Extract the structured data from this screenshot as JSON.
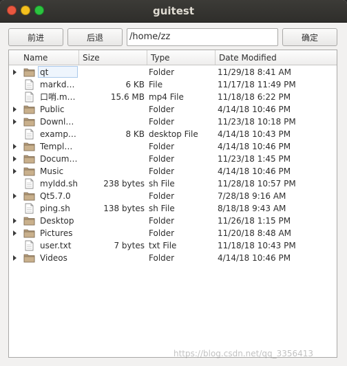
{
  "window": {
    "title": "guitest"
  },
  "toolbar": {
    "forward_label": "前进",
    "back_label": "后退",
    "path_value": "/home/zz",
    "confirm_label": "确定"
  },
  "table": {
    "columns": [
      "Name",
      "Size",
      "Type",
      "Date Modified"
    ],
    "rows": [
      {
        "name": "qt",
        "size": "",
        "type": "Folder",
        "date": "11/29/18 8:41 AM",
        "kind": "folder",
        "expandable": true,
        "selected": true
      },
      {
        "name": "markd…",
        "size": "6 KB",
        "type": "File",
        "date": "11/17/18 11:49 PM",
        "kind": "file",
        "expandable": false
      },
      {
        "name": "口哨.m…",
        "size": "15.6 MB",
        "type": "mp4 File",
        "date": "11/18/18 6:22 PM",
        "kind": "file",
        "expandable": false
      },
      {
        "name": "Public",
        "size": "",
        "type": "Folder",
        "date": "4/14/18 10:46 PM",
        "kind": "folder",
        "expandable": true
      },
      {
        "name": "Downl…",
        "size": "",
        "type": "Folder",
        "date": "11/23/18 10:18 PM",
        "kind": "folder",
        "expandable": true
      },
      {
        "name": "examp…",
        "size": "8 KB",
        "type": "desktop File",
        "date": "4/14/18 10:43 PM",
        "kind": "file",
        "expandable": false
      },
      {
        "name": "Templ…",
        "size": "",
        "type": "Folder",
        "date": "4/14/18 10:46 PM",
        "kind": "folder",
        "expandable": true
      },
      {
        "name": "Docum…",
        "size": "",
        "type": "Folder",
        "date": "11/23/18 1:45 PM",
        "kind": "folder",
        "expandable": true
      },
      {
        "name": "Music",
        "size": "",
        "type": "Folder",
        "date": "4/14/18 10:46 PM",
        "kind": "folder",
        "expandable": true
      },
      {
        "name": "myldd.sh",
        "size": "238 bytes",
        "type": "sh File",
        "date": "11/28/18 10:57 PM",
        "kind": "file",
        "expandable": false
      },
      {
        "name": "Qt5.7.0",
        "size": "",
        "type": "Folder",
        "date": "7/28/18 9:16 AM",
        "kind": "folder",
        "expandable": true
      },
      {
        "name": "ping.sh",
        "size": "138 bytes",
        "type": "sh File",
        "date": "8/18/18 9:43 AM",
        "kind": "file",
        "expandable": false
      },
      {
        "name": "Desktop",
        "size": "",
        "type": "Folder",
        "date": "11/26/18 1:15 PM",
        "kind": "folder",
        "expandable": true
      },
      {
        "name": "Pictures",
        "size": "",
        "type": "Folder",
        "date": "11/20/18 8:48 AM",
        "kind": "folder",
        "expandable": true
      },
      {
        "name": "user.txt",
        "size": "7 bytes",
        "type": "txt File",
        "date": "11/18/18 10:43 PM",
        "kind": "file",
        "expandable": false
      },
      {
        "name": "Videos",
        "size": "",
        "type": "Folder",
        "date": "4/14/18 10:46 PM",
        "kind": "folder",
        "expandable": true
      }
    ]
  },
  "watermark": "https://blog.csdn.net/qq_3356413"
}
